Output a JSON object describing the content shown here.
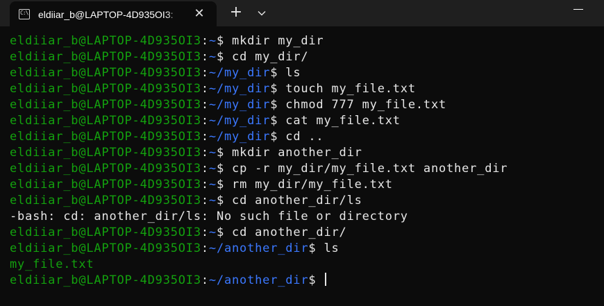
{
  "window": {
    "tab_title": "eldiiar_b@LAPTOP-4D935OI3:",
    "tab_icon_glyph": "C:\\",
    "close_glyph": "✕",
    "new_tab_glyph": "+"
  },
  "colors": {
    "background": "#0c0c0c",
    "titlebar": "#1f1f1f",
    "prompt_user": "#13a10e",
    "prompt_path": "#3b78ff",
    "text": "#e6e6e6"
  },
  "terminal": {
    "lines": [
      {
        "user": "eldiiar_b@LAPTOP-4D935OI3",
        "path": "~",
        "cmd": "mkdir my_dir"
      },
      {
        "user": "eldiiar_b@LAPTOP-4D935OI3",
        "path": "~",
        "cmd": "cd my_dir/"
      },
      {
        "user": "eldiiar_b@LAPTOP-4D935OI3",
        "path": "~/my_dir",
        "cmd": "ls"
      },
      {
        "user": "eldiiar_b@LAPTOP-4D935OI3",
        "path": "~/my_dir",
        "cmd": "touch my_file.txt"
      },
      {
        "user": "eldiiar_b@LAPTOP-4D935OI3",
        "path": "~/my_dir",
        "cmd": "chmod 777 my_file.txt"
      },
      {
        "user": "eldiiar_b@LAPTOP-4D935OI3",
        "path": "~/my_dir",
        "cmd": "cat my_file.txt"
      },
      {
        "user": "eldiiar_b@LAPTOP-4D935OI3",
        "path": "~/my_dir",
        "cmd": "cd .."
      },
      {
        "user": "eldiiar_b@LAPTOP-4D935OI3",
        "path": "~",
        "cmd": "mkdir another_dir"
      },
      {
        "user": "eldiiar_b@LAPTOP-4D935OI3",
        "path": "~",
        "cmd": "cp -r my_dir/my_file.txt another_dir"
      },
      {
        "user": "eldiiar_b@LAPTOP-4D935OI3",
        "path": "~",
        "cmd": "rm my_dir/my_file.txt"
      },
      {
        "user": "eldiiar_b@LAPTOP-4D935OI3",
        "path": "~",
        "cmd": "cd another_dir/ls"
      },
      {
        "output": "-bash: cd: another_dir/ls: No such file or directory",
        "style": "w"
      },
      {
        "user": "eldiiar_b@LAPTOP-4D935OI3",
        "path": "~",
        "cmd": "cd another_dir/"
      },
      {
        "user": "eldiiar_b@LAPTOP-4D935OI3",
        "path": "~/another_dir",
        "cmd": "ls"
      },
      {
        "output": "my_file.txt",
        "style": "g"
      },
      {
        "user": "eldiiar_b@LAPTOP-4D935OI3",
        "path": "~/another_dir",
        "cmd": "",
        "cursor": true
      }
    ]
  }
}
